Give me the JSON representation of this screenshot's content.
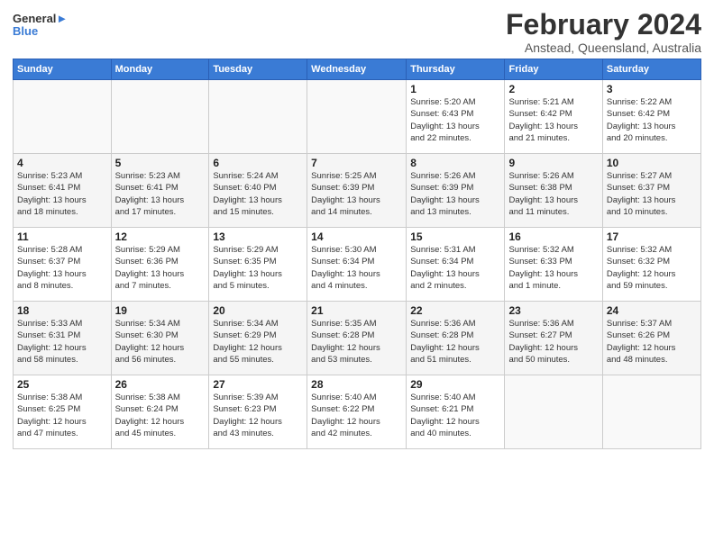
{
  "header": {
    "logo_line1": "General",
    "logo_line2": "Blue",
    "month_title": "February 2024",
    "location": "Anstead, Queensland, Australia"
  },
  "weekdays": [
    "Sunday",
    "Monday",
    "Tuesday",
    "Wednesday",
    "Thursday",
    "Friday",
    "Saturday"
  ],
  "weeks": [
    [
      {
        "day": "",
        "info": ""
      },
      {
        "day": "",
        "info": ""
      },
      {
        "day": "",
        "info": ""
      },
      {
        "day": "",
        "info": ""
      },
      {
        "day": "1",
        "info": "Sunrise: 5:20 AM\nSunset: 6:43 PM\nDaylight: 13 hours\nand 22 minutes."
      },
      {
        "day": "2",
        "info": "Sunrise: 5:21 AM\nSunset: 6:42 PM\nDaylight: 13 hours\nand 21 minutes."
      },
      {
        "day": "3",
        "info": "Sunrise: 5:22 AM\nSunset: 6:42 PM\nDaylight: 13 hours\nand 20 minutes."
      }
    ],
    [
      {
        "day": "4",
        "info": "Sunrise: 5:23 AM\nSunset: 6:41 PM\nDaylight: 13 hours\nand 18 minutes."
      },
      {
        "day": "5",
        "info": "Sunrise: 5:23 AM\nSunset: 6:41 PM\nDaylight: 13 hours\nand 17 minutes."
      },
      {
        "day": "6",
        "info": "Sunrise: 5:24 AM\nSunset: 6:40 PM\nDaylight: 13 hours\nand 15 minutes."
      },
      {
        "day": "7",
        "info": "Sunrise: 5:25 AM\nSunset: 6:39 PM\nDaylight: 13 hours\nand 14 minutes."
      },
      {
        "day": "8",
        "info": "Sunrise: 5:26 AM\nSunset: 6:39 PM\nDaylight: 13 hours\nand 13 minutes."
      },
      {
        "day": "9",
        "info": "Sunrise: 5:26 AM\nSunset: 6:38 PM\nDaylight: 13 hours\nand 11 minutes."
      },
      {
        "day": "10",
        "info": "Sunrise: 5:27 AM\nSunset: 6:37 PM\nDaylight: 13 hours\nand 10 minutes."
      }
    ],
    [
      {
        "day": "11",
        "info": "Sunrise: 5:28 AM\nSunset: 6:37 PM\nDaylight: 13 hours\nand 8 minutes."
      },
      {
        "day": "12",
        "info": "Sunrise: 5:29 AM\nSunset: 6:36 PM\nDaylight: 13 hours\nand 7 minutes."
      },
      {
        "day": "13",
        "info": "Sunrise: 5:29 AM\nSunset: 6:35 PM\nDaylight: 13 hours\nand 5 minutes."
      },
      {
        "day": "14",
        "info": "Sunrise: 5:30 AM\nSunset: 6:34 PM\nDaylight: 13 hours\nand 4 minutes."
      },
      {
        "day": "15",
        "info": "Sunrise: 5:31 AM\nSunset: 6:34 PM\nDaylight: 13 hours\nand 2 minutes."
      },
      {
        "day": "16",
        "info": "Sunrise: 5:32 AM\nSunset: 6:33 PM\nDaylight: 13 hours\nand 1 minute."
      },
      {
        "day": "17",
        "info": "Sunrise: 5:32 AM\nSunset: 6:32 PM\nDaylight: 12 hours\nand 59 minutes."
      }
    ],
    [
      {
        "day": "18",
        "info": "Sunrise: 5:33 AM\nSunset: 6:31 PM\nDaylight: 12 hours\nand 58 minutes."
      },
      {
        "day": "19",
        "info": "Sunrise: 5:34 AM\nSunset: 6:30 PM\nDaylight: 12 hours\nand 56 minutes."
      },
      {
        "day": "20",
        "info": "Sunrise: 5:34 AM\nSunset: 6:29 PM\nDaylight: 12 hours\nand 55 minutes."
      },
      {
        "day": "21",
        "info": "Sunrise: 5:35 AM\nSunset: 6:28 PM\nDaylight: 12 hours\nand 53 minutes."
      },
      {
        "day": "22",
        "info": "Sunrise: 5:36 AM\nSunset: 6:28 PM\nDaylight: 12 hours\nand 51 minutes."
      },
      {
        "day": "23",
        "info": "Sunrise: 5:36 AM\nSunset: 6:27 PM\nDaylight: 12 hours\nand 50 minutes."
      },
      {
        "day": "24",
        "info": "Sunrise: 5:37 AM\nSunset: 6:26 PM\nDaylight: 12 hours\nand 48 minutes."
      }
    ],
    [
      {
        "day": "25",
        "info": "Sunrise: 5:38 AM\nSunset: 6:25 PM\nDaylight: 12 hours\nand 47 minutes."
      },
      {
        "day": "26",
        "info": "Sunrise: 5:38 AM\nSunset: 6:24 PM\nDaylight: 12 hours\nand 45 minutes."
      },
      {
        "day": "27",
        "info": "Sunrise: 5:39 AM\nSunset: 6:23 PM\nDaylight: 12 hours\nand 43 minutes."
      },
      {
        "day": "28",
        "info": "Sunrise: 5:40 AM\nSunset: 6:22 PM\nDaylight: 12 hours\nand 42 minutes."
      },
      {
        "day": "29",
        "info": "Sunrise: 5:40 AM\nSunset: 6:21 PM\nDaylight: 12 hours\nand 40 minutes."
      },
      {
        "day": "",
        "info": ""
      },
      {
        "day": "",
        "info": ""
      }
    ]
  ]
}
